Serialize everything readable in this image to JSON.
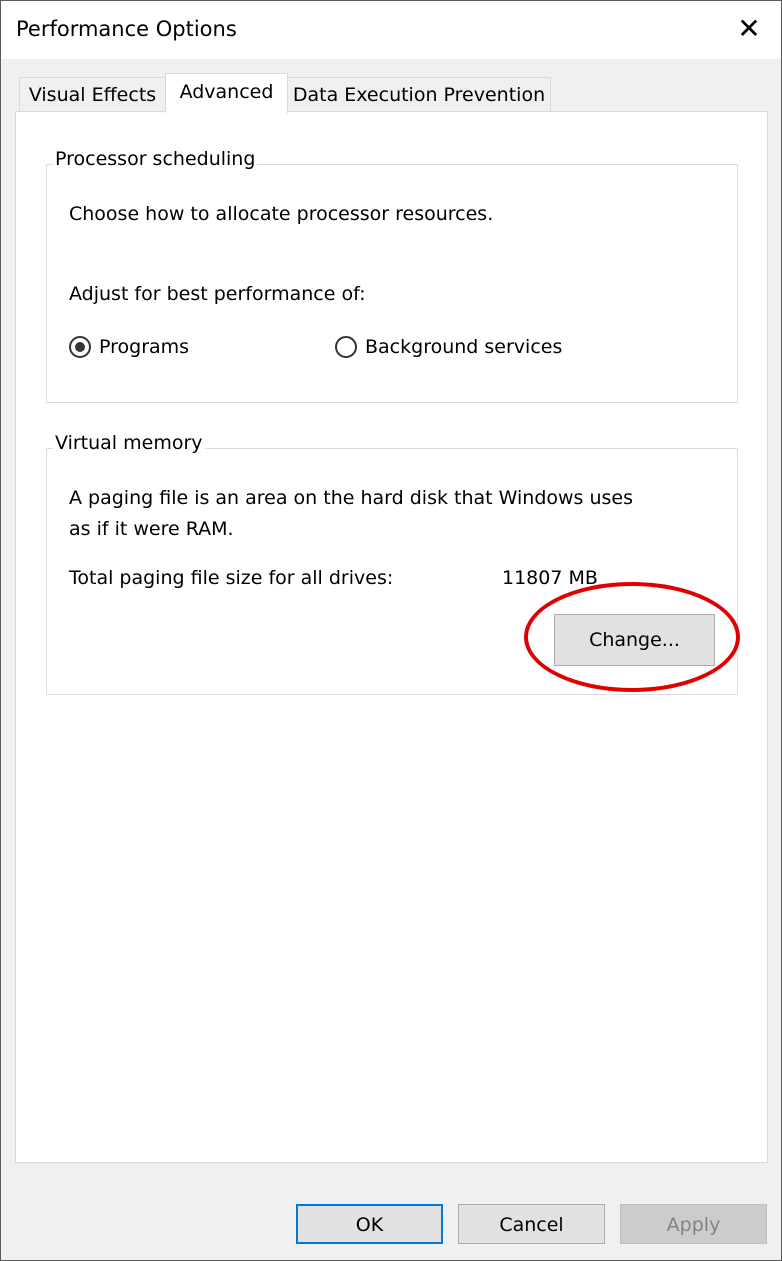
{
  "window": {
    "title": "Performance Options"
  },
  "tabs": [
    {
      "label": "Visual Effects",
      "active": false
    },
    {
      "label": "Advanced",
      "active": true
    },
    {
      "label": "Data Execution Prevention",
      "active": false
    }
  ],
  "processor": {
    "group_label": "Processor scheduling",
    "description": "Choose how to allocate processor resources.",
    "adjust_label": "Adjust for best performance of:",
    "options": [
      {
        "label": "Programs",
        "selected": true
      },
      {
        "label": "Background services",
        "selected": false
      }
    ]
  },
  "virtual_memory": {
    "group_label": "Virtual memory",
    "description_line1": "A paging file is an area on the hard disk that Windows uses",
    "description_line2": "as if it were RAM.",
    "total_label": "Total paging file size for all drives:",
    "total_value": "11807 MB",
    "change_button": "Change..."
  },
  "footer": {
    "ok": "OK",
    "cancel": "Cancel",
    "apply": "Apply"
  },
  "annotation": {
    "color": "#e00000",
    "target": "Change..."
  }
}
